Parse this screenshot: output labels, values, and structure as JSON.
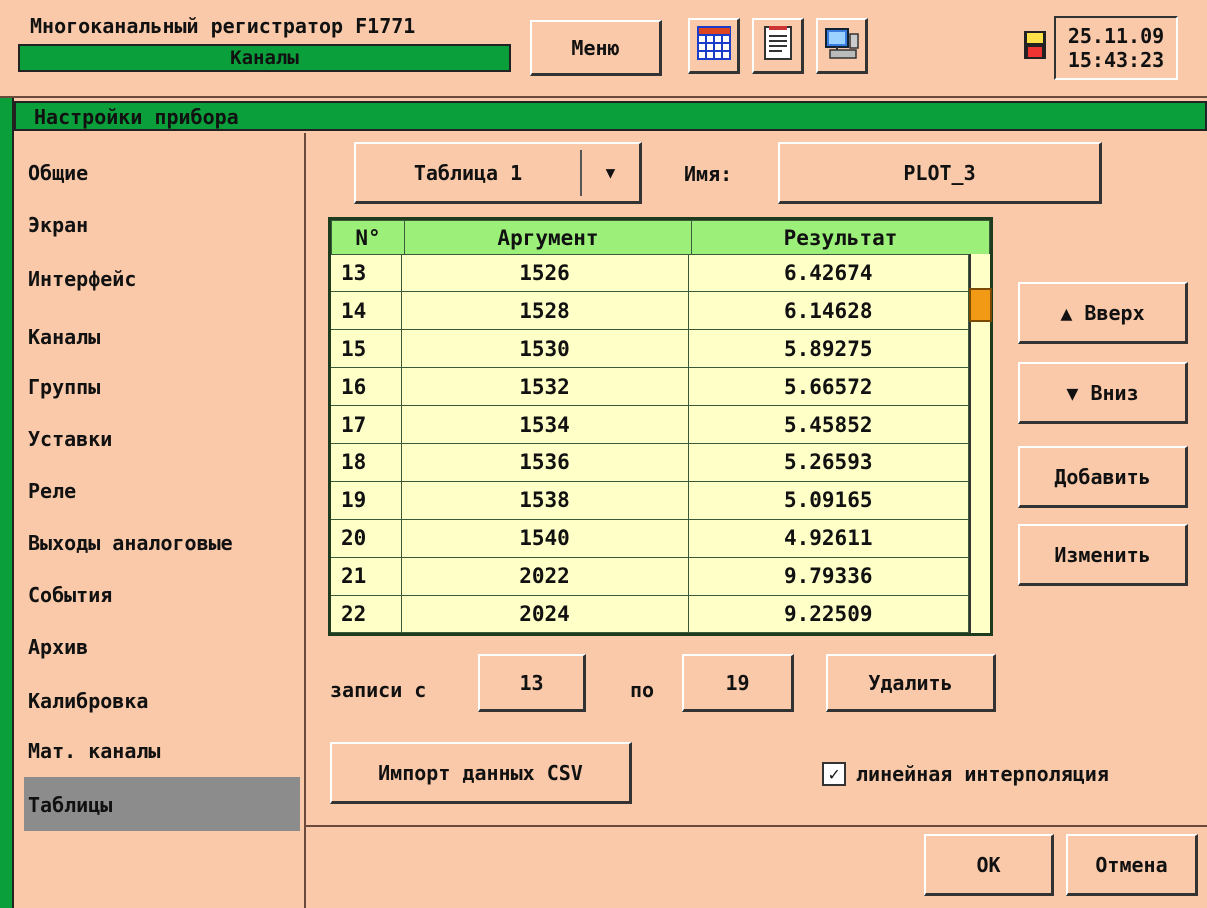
{
  "header": {
    "title": "Многоканальный регистратор F1771",
    "subtitle": "Каналы",
    "menu_label": "Меню",
    "date": "25.11.09",
    "time": "15:43:23"
  },
  "section_title": "Настройки прибора",
  "sidebar": {
    "items": [
      {
        "label": "Общие"
      },
      {
        "label": "Экран"
      },
      {
        "label": "Интерфейс"
      },
      {
        "label": "Каналы"
      },
      {
        "label": "Группы"
      },
      {
        "label": "Уставки"
      },
      {
        "label": "Реле"
      },
      {
        "label": "Выходы аналоговые"
      },
      {
        "label": "События"
      },
      {
        "label": "Архив"
      },
      {
        "label": "Калибровка"
      },
      {
        "label": "Мат. каналы"
      },
      {
        "label": "Таблицы"
      }
    ],
    "selected": "Таблицы"
  },
  "table_select": {
    "value": "Таблица 1",
    "arrow": "▼"
  },
  "name_field": {
    "label": "Имя:",
    "value": "PLOT_3"
  },
  "grid": {
    "headers": [
      "N°",
      "Аргумент",
      "Результат"
    ],
    "rows": [
      [
        "13",
        "1526",
        "6.42674"
      ],
      [
        "14",
        "1528",
        "6.14628"
      ],
      [
        "15",
        "1530",
        "5.89275"
      ],
      [
        "16",
        "1532",
        "5.66572"
      ],
      [
        "17",
        "1534",
        "5.45852"
      ],
      [
        "18",
        "1536",
        "5.26593"
      ],
      [
        "19",
        "1538",
        "5.09165"
      ],
      [
        "20",
        "1540",
        "4.92611"
      ],
      [
        "21",
        "2022",
        "9.79336"
      ],
      [
        "22",
        "2024",
        "9.22509"
      ]
    ]
  },
  "side_buttons": {
    "up": "▲ Вверх",
    "down": "▼ Вниз",
    "add": "Добавить",
    "edit": "Изменить"
  },
  "range": {
    "from_label": "записи с",
    "from_value": "13",
    "to_label": "по",
    "to_value": "19",
    "delete_label": "Удалить"
  },
  "import_label": "Импорт данных CSV",
  "interp": {
    "checked": true,
    "check_mark": "✓",
    "label": "линейная интерполяция"
  },
  "footer": {
    "ok": "OK",
    "cancel": "Отмена"
  },
  "colors": {
    "background": "#f9c9a9",
    "green": "#0b9f3b",
    "table_bg": "#ffffc8",
    "header_bg": "#9cf07a",
    "scroll_thumb": "#f29a16",
    "nav_selected": "#8c8c8c"
  }
}
